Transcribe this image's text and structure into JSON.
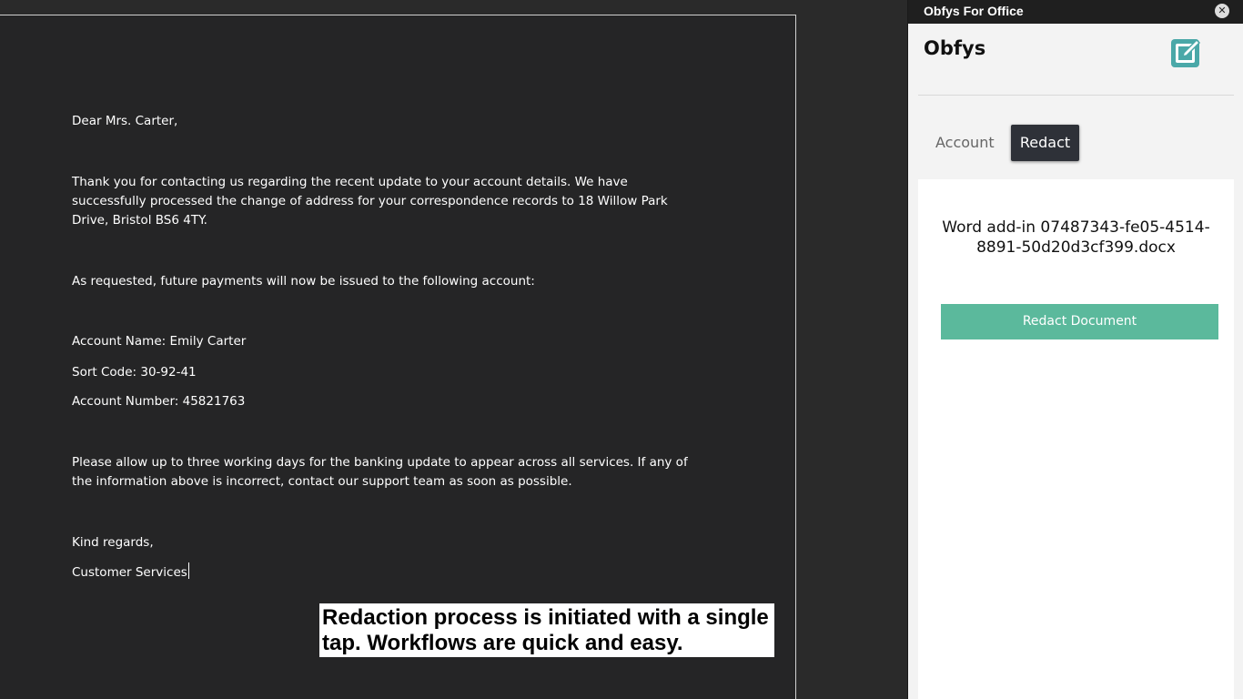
{
  "document": {
    "greeting": "Dear Mrs. Carter,",
    "paragraph1": "Thank you for contacting us regarding the recent update to your account details. We have successfully processed the change of address for your correspondence records to 18 Willow Park Drive, Bristol BS6 4TY.",
    "paragraph2": "As requested, future payments will now be issued to the following account:",
    "account_name": "Account Name: Emily Carter",
    "sort_code": "Sort Code: 30-92-41",
    "account_number": "Account Number: 45821763",
    "paragraph3": "Please allow up to three working days for the banking update to appear across all services. If any of the information above is incorrect, contact our support team as soon as possible.",
    "closing": "Kind regards,",
    "signature": "Customer Services"
  },
  "caption": "Redaction process is initiated with a single tap. Workflows are quick and easy.",
  "pane": {
    "title": "Obfys For Office",
    "close_glyph": "✕",
    "brand": "Obfys",
    "logo_icon": "edit-square-icon",
    "logo_color": "#4aa8a8",
    "tabs": [
      {
        "label": "Account",
        "active": false
      },
      {
        "label": "Redact",
        "active": true
      }
    ],
    "document_name": "Word add-in 07487343-fe05-4514-8891-50d20d3cf399.docx",
    "redact_button_label": "Redact Document",
    "accent_color": "#5bb99c"
  }
}
